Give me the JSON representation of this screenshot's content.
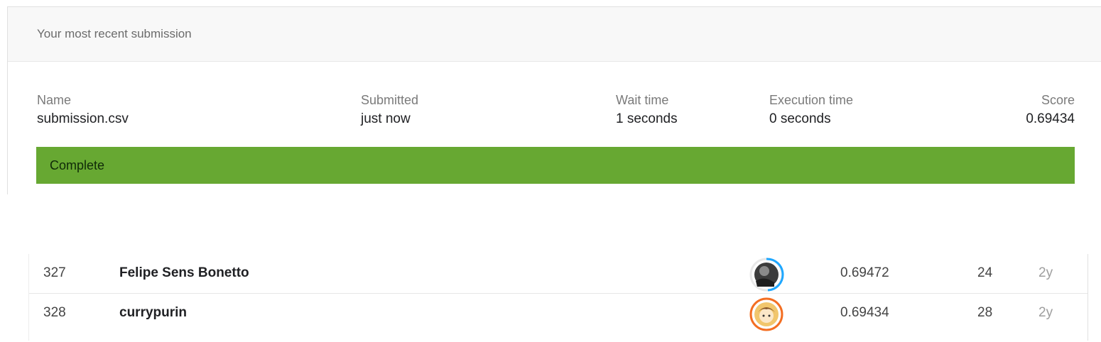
{
  "submission": {
    "header": "Your most recent submission",
    "columns": {
      "name": {
        "label": "Name",
        "value": "submission.csv"
      },
      "submitted": {
        "label": "Submitted",
        "value": "just now"
      },
      "wait": {
        "label": "Wait time",
        "value": "1 seconds"
      },
      "exec": {
        "label": "Execution time",
        "value": "0 seconds"
      },
      "score": {
        "label": "Score",
        "value": "0.69434"
      }
    },
    "status": "Complete",
    "status_color": "#67a832"
  },
  "leaderboard": {
    "rows": [
      {
        "rank": "327",
        "team": "Felipe Sens Bonetto",
        "avatar": "user-avatar-icon",
        "ring_color": "#1ea7ff",
        "score": "0.69472",
        "entries": "24",
        "last": "2y"
      },
      {
        "rank": "328",
        "team": "currypurin",
        "avatar": "user-avatar-icon",
        "ring_color": "#f36e22",
        "score": "0.69434",
        "entries": "28",
        "last": "2y"
      }
    ]
  }
}
